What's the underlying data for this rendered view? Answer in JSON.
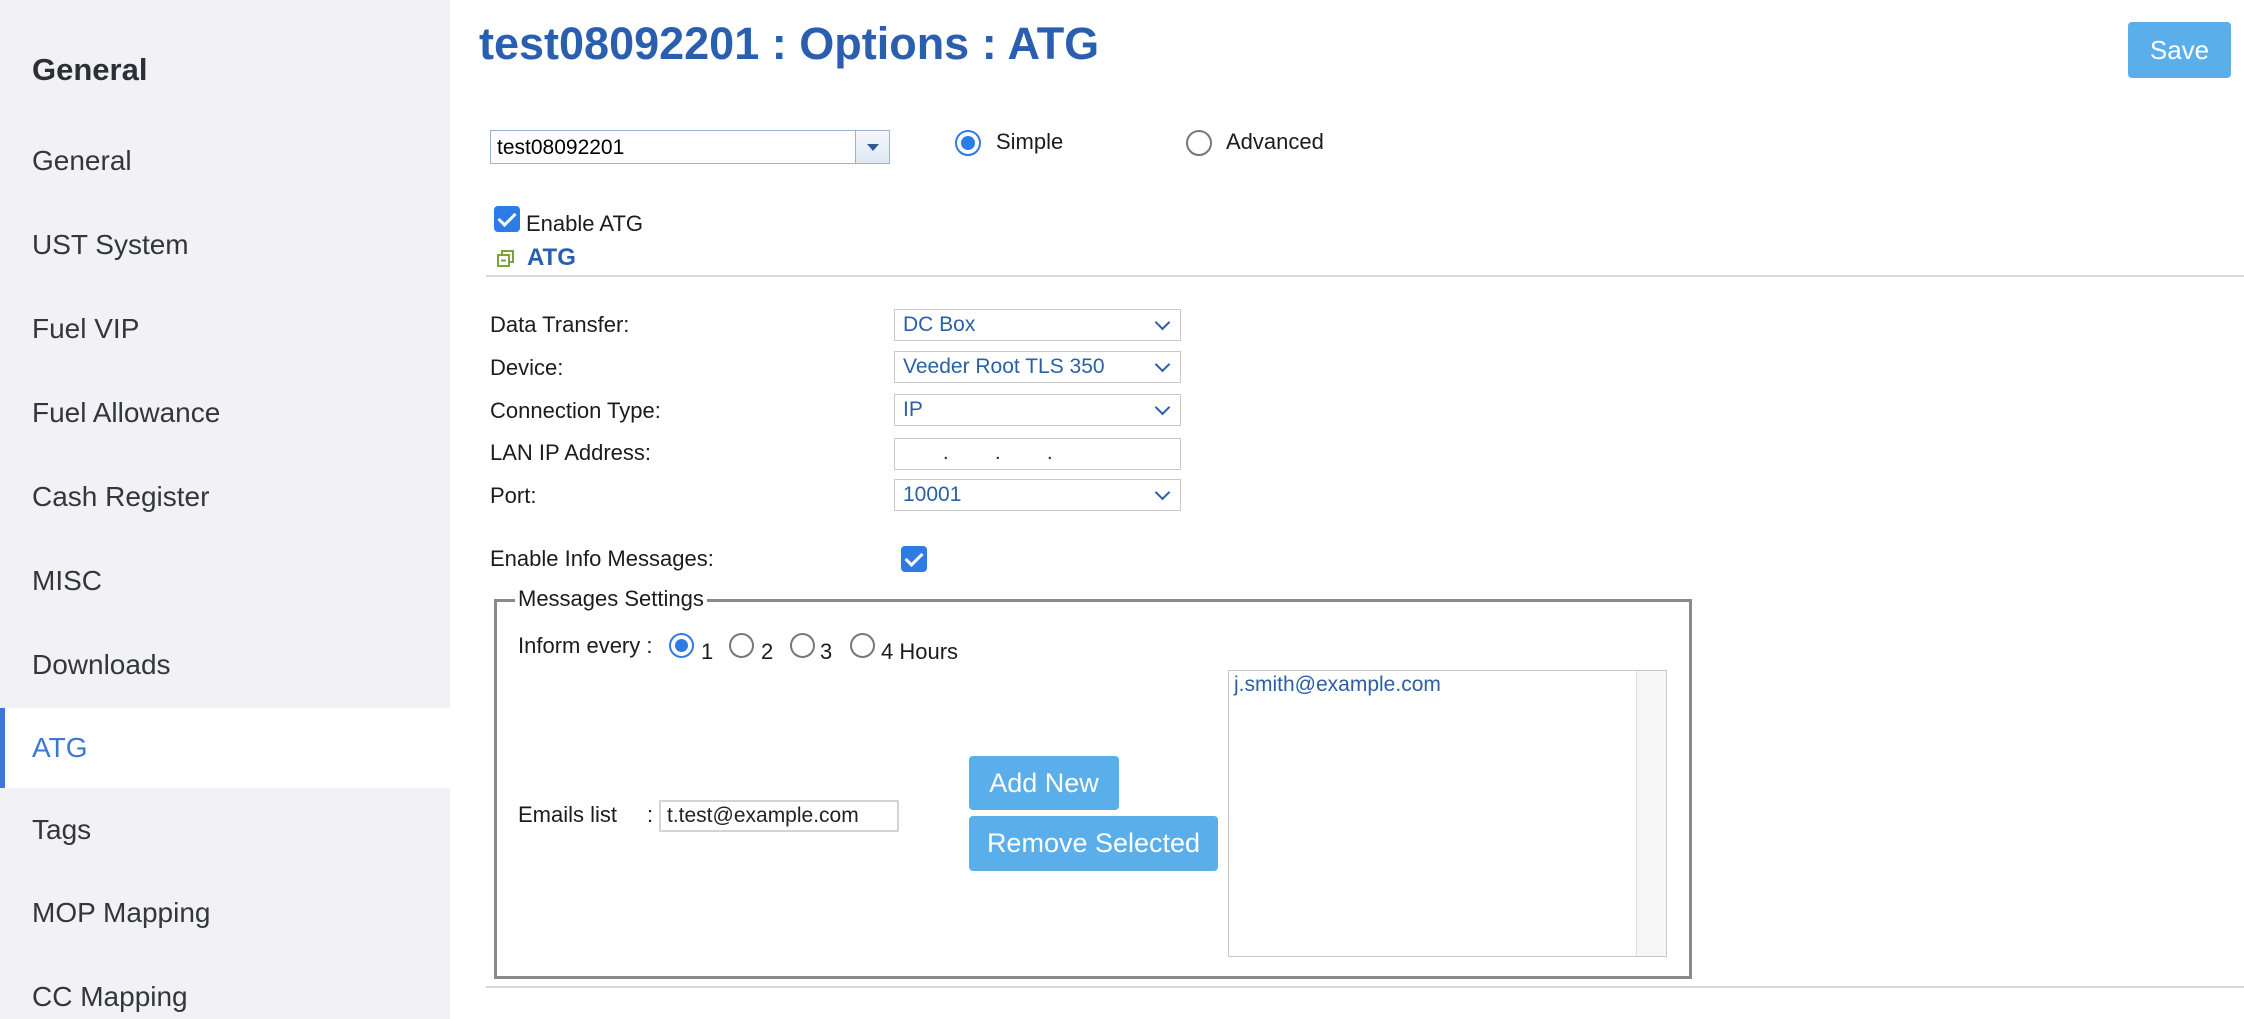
{
  "sidebar": {
    "heading": "General",
    "items": [
      {
        "label": "General"
      },
      {
        "label": "UST System"
      },
      {
        "label": "Fuel VIP"
      },
      {
        "label": "Fuel Allowance"
      },
      {
        "label": "Cash Register"
      },
      {
        "label": "MISC"
      },
      {
        "label": "Downloads"
      },
      {
        "label": "ATG",
        "active": true
      },
      {
        "label": "Tags"
      },
      {
        "label": "MOP Mapping"
      },
      {
        "label": "CC Mapping"
      }
    ]
  },
  "header": {
    "title": "test08092201 : Options : ATG",
    "save_label": "Save"
  },
  "site_select": {
    "value": "test08092201"
  },
  "mode": {
    "simple_label": "Simple",
    "advanced_label": "Advanced",
    "selected": "Simple"
  },
  "enable_atg": {
    "label": "Enable ATG",
    "checked": true
  },
  "section": {
    "title": "ATG"
  },
  "form": {
    "data_transfer": {
      "label": "Data Transfer:",
      "value": "DC Box"
    },
    "device": {
      "label": "Device:",
      "value": "Veeder Root TLS 350"
    },
    "connection_type": {
      "label": "Connection Type:",
      "value": "IP"
    },
    "lan_ip": {
      "label": "LAN IP Address:",
      "dot": "."
    },
    "port": {
      "label": "Port:",
      "value": "10001"
    },
    "info_messages": {
      "label": "Enable Info Messages:",
      "checked": true
    }
  },
  "messages_settings": {
    "legend": "Messages Settings",
    "inform_label": "Inform every :",
    "options": [
      "1",
      "2",
      "3",
      "4 Hours"
    ],
    "selected": "1",
    "emails_label": "Emails list",
    "colon": ":",
    "email_input_value": "t.test@example.com",
    "add_new_label": "Add New",
    "remove_selected_label": "Remove Selected",
    "emails": [
      "j.smith@example.com"
    ]
  },
  "colors": {
    "accent": "#3a77d9",
    "title": "#2a5fb0",
    "button": "#5aaeea",
    "sidebar_bg": "#f2f2f4"
  }
}
